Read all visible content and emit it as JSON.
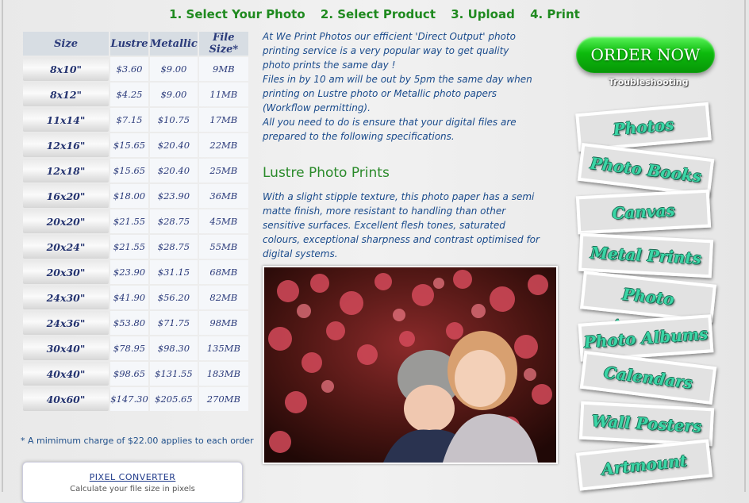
{
  "steps": [
    "1. Select Your Photo",
    "2. Select Product",
    "3. Upload",
    "4. Print"
  ],
  "table": {
    "headers": [
      "Size",
      "Lustre",
      "Metallic",
      "File Size*"
    ],
    "rows": [
      [
        "8x10\"",
        "$3.60",
        "$9.00",
        "9MB"
      ],
      [
        "8x12\"",
        "$4.25",
        "$9.00",
        "11MB"
      ],
      [
        "11x14\"",
        "$7.15",
        "$10.75",
        "17MB"
      ],
      [
        "12x16\"",
        "$15.65",
        "$20.40",
        "22MB"
      ],
      [
        "12x18\"",
        "$15.65",
        "$20.40",
        "25MB"
      ],
      [
        "16x20\"",
        "$18.00",
        "$23.90",
        "36MB"
      ],
      [
        "20x20\"",
        "$21.55",
        "$28.75",
        "45MB"
      ],
      [
        "20x24\"",
        "$21.55",
        "$28.75",
        "55MB"
      ],
      [
        "20x30\"",
        "$23.90",
        "$31.15",
        "68MB"
      ],
      [
        "24x30\"",
        "$41.90",
        "$56.20",
        "82MB"
      ],
      [
        "24x36\"",
        "$53.80",
        "$71.75",
        "98MB"
      ],
      [
        "30x40\"",
        "$78.95",
        "$98.30",
        "135MB"
      ],
      [
        "40x40\"",
        "$98.65",
        "$131.55",
        "183MB"
      ],
      [
        "40x60\"",
        "$147.30",
        "$205.65",
        "270MB"
      ]
    ],
    "note": "* A mimimum charge of $22.00 applies to each order"
  },
  "pixel_converter": {
    "link": "PIXEL CONVERTER",
    "sub": "Calculate your file size in pixels"
  },
  "intro": [
    "At We Print Photos our efficient 'Direct Output' photo printing service is a very popular way to get quality photo prints the same day !",
    "Files in by 10 am will be out by 5pm the same day when printing on Lustre photo or Metallic photo papers (Workflow permitting).",
    "All you need to do is ensure that your digital files are prepared to the following specifications."
  ],
  "lustre": {
    "heading": "Lustre Photo Prints",
    "text": "With a slight stipple texture, this photo paper has a semi matte finish, more resistant to handling than other sensitive surfaces. Excellent flesh tones, saturated colours, exceptional sharpness and contrast optimised for digital systems."
  },
  "order_button": "ORDER NOW",
  "troubleshooting": "Troubleshooting",
  "nav": [
    "Photos",
    "Photo Books",
    "Canvas",
    "Metal Prints",
    "Photo Acrylics",
    "Photo Albums",
    "Calendars",
    "Wall Posters",
    "Artmount"
  ],
  "colors": {
    "accent_green": "#1f8a1f",
    "text_blue": "#1a4b8c",
    "nav_text": "#3ad6a6"
  }
}
